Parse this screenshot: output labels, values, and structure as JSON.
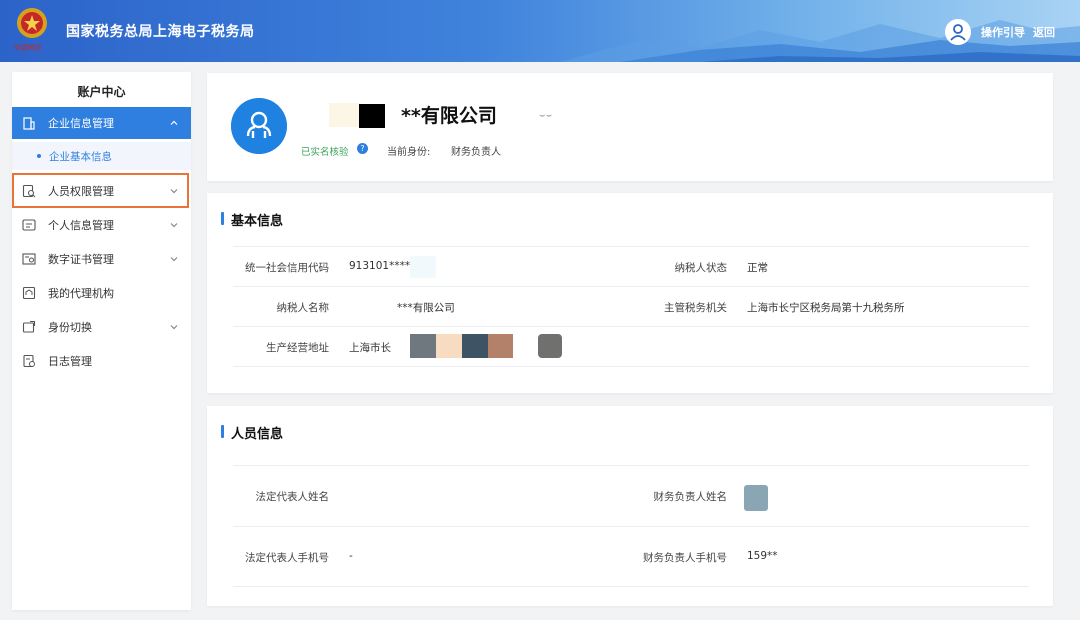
{
  "header": {
    "emblem_text": "中国税务",
    "title": "国家税务总局上海电子税务局",
    "guide_link": "操作引导",
    "back_link": "返回"
  },
  "sidebar": {
    "title": "账户中心",
    "items": [
      {
        "label": "企业信息管理",
        "icon": "building-icon"
      },
      {
        "label": "人员权限管理",
        "icon": "person-search-icon"
      },
      {
        "label": "个人信息管理",
        "icon": "id-card-icon"
      },
      {
        "label": "数字证书管理",
        "icon": "certificate-icon"
      },
      {
        "label": "我的代理机构",
        "icon": "agency-icon"
      },
      {
        "label": "身份切换",
        "icon": "switch-icon"
      },
      {
        "label": "日志管理",
        "icon": "log-icon"
      }
    ],
    "sub_item": "企业基本信息"
  },
  "profile": {
    "company_name": "**有限公司",
    "verified": "已实名核验",
    "current_identity_label": "当前身份:",
    "current_identity_value": "财务负责人"
  },
  "basic_info": {
    "title": "基本信息",
    "fields": [
      {
        "label": "统一社会信用代码",
        "value": "913101****"
      },
      {
        "label": "纳税人状态",
        "value": "正常"
      },
      {
        "label": "纳税人名称",
        "value": "***有限公司"
      },
      {
        "label": "主管税务机关",
        "value": "上海市长宁区税务局第十九税务所"
      },
      {
        "label": "生产经营地址",
        "value": "上海市长"
      }
    ]
  },
  "personnel_info": {
    "title": "人员信息",
    "fields": [
      {
        "label": "法定代表人姓名",
        "value": ""
      },
      {
        "label": "财务负责人姓名",
        "value": ""
      },
      {
        "label": "法定代表人手机号",
        "value": "-"
      },
      {
        "label": "财务负责人手机号",
        "value": "159**"
      }
    ]
  },
  "colors": {
    "primary": "#2f7fe0",
    "highlight_border": "#e9743a",
    "verified_green": "#3aa35b"
  }
}
